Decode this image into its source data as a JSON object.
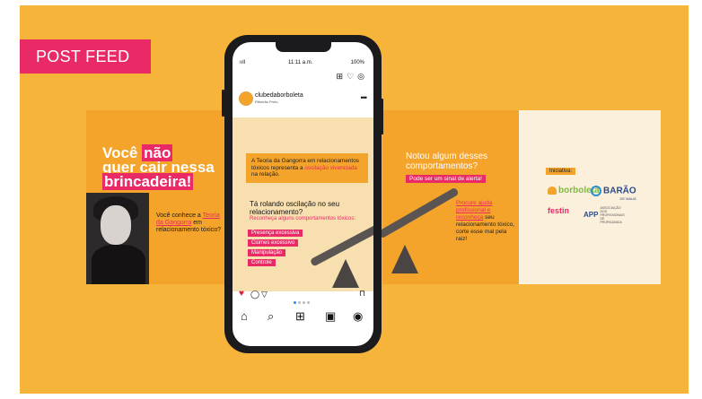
{
  "badge": {
    "label": "POST FEED"
  },
  "phone": {
    "time": "11:11 a.m.",
    "signal": "ııll",
    "battery": "100%",
    "account": "clubedaborboleta",
    "location": "Ribeirão Preto",
    "icons": {
      "top": [
        "plus-square-icon",
        "heart-icon",
        "messenger-icon"
      ],
      "actions": [
        "heart-icon",
        "comment-icon",
        "share-icon",
        "bookmark-icon"
      ],
      "nav": [
        "home-icon",
        "search-icon",
        "add-icon",
        "reels-icon",
        "profile-icon"
      ]
    },
    "pager": {
      "count": 4,
      "active": 0
    }
  },
  "slide1": {
    "line1": "Você",
    "highlight": "não",
    "line2": "quer cair nessa",
    "line3": "brincadeira!",
    "small_pre": "Você conhece a",
    "small_link": "Teoria da Gangorra",
    "small_post": "em relacionamento tóxico?"
  },
  "slide2": {
    "callout_pre": "A Teoria da Gangorra em relacionamentos tóxicos representa a",
    "callout_em": "oscilação vivenciada",
    "callout_post": "na relação.",
    "question": "Tá rolando oscilação no seu relacionamento?",
    "sub": "Reconheça alguns comportamentos tóxicos:",
    "tags": [
      "Presença excessiva",
      "Ciúmes excessivo",
      "Manipulação",
      "Controle"
    ]
  },
  "slide3": {
    "title": "Notou algum desses comportamentos?",
    "alert": "Pode ser um sinal de alerta!",
    "body_link": "Procure ajuda profissional e reconheça",
    "body_post": "seu relacionamento tóxico, corte esse mal pela raiz!"
  },
  "slide4": {
    "label": "Iniciativa:",
    "logo1": "borboleta",
    "logo2": "BARÃO",
    "logo2_sub": "DE MAUÁ",
    "logo3a": "festin",
    "logo4": "APP",
    "logo4_sub": "ASSOCIAÇÃO DOS PROFISSIONAIS DE PROPAGANDA"
  },
  "colors": {
    "background": "#f6b43a",
    "accent": "#ea2a66",
    "orange": "#f4a32b",
    "phone": "#1b1b1d"
  }
}
